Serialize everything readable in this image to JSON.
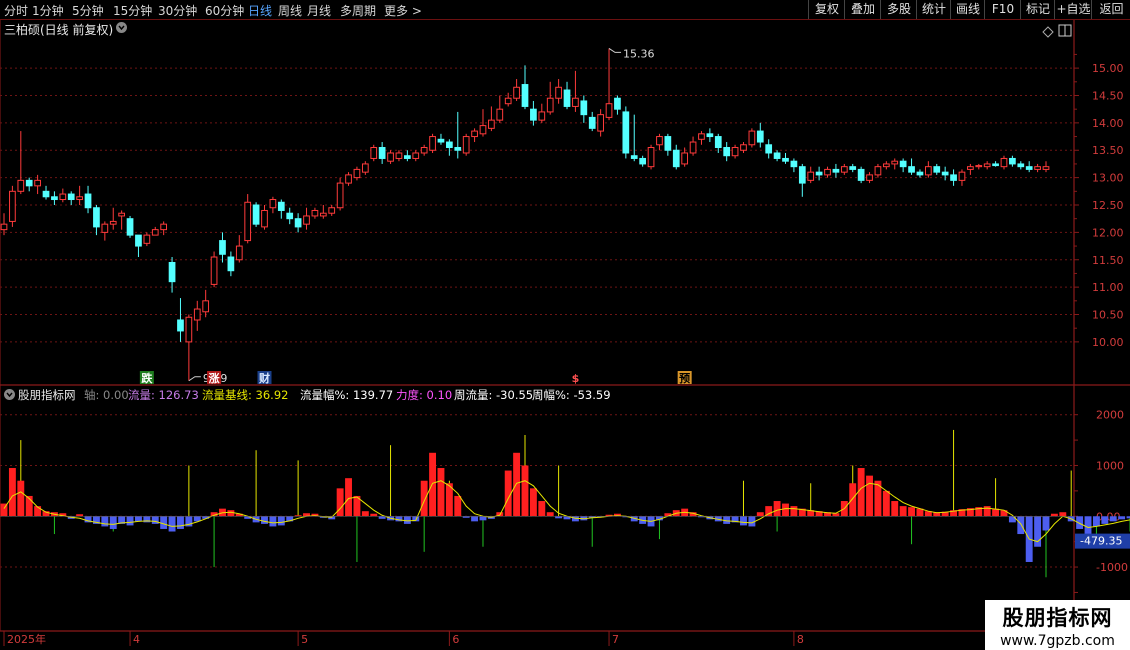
{
  "toolbar": {
    "periods": [
      "分时",
      "1分钟",
      "5分钟",
      "15分钟",
      "30分钟",
      "60分钟",
      "日线",
      "周线",
      "月线",
      "多周期",
      "更多 >"
    ],
    "active_period": "日线",
    "right_buttons": [
      "复权",
      "叠加",
      "多股",
      "统计",
      "画线",
      "F10",
      "标记",
      "+自选",
      "返回"
    ]
  },
  "main_chart": {
    "title": "三柏硕(日线 前复权)",
    "y_ticks": [
      "15.00",
      "14.50",
      "14.00",
      "13.50",
      "13.00",
      "12.50",
      "12.00",
      "11.50",
      "11.00",
      "10.50",
      "10.00"
    ],
    "y_range": [
      9.45,
      15.55
    ],
    "high_marker": "15.36",
    "low_marker": "9.29",
    "event_labels": [
      {
        "text": "跌",
        "color": "#ffffff",
        "bg": "#1e7d1e",
        "index": 17
      },
      {
        "text": "涨",
        "color": "#ffffff",
        "bg": "#b01818",
        "index": 25
      },
      {
        "text": "财",
        "color": "#d8e8ff",
        "bg": "#1a3f8a",
        "index": 31
      },
      {
        "text": "$",
        "color": "#ff5050",
        "bg": "transparent",
        "index": 68
      },
      {
        "text": "预",
        "color": "#000000",
        "bg": "#d9962a",
        "index": 81
      }
    ]
  },
  "indicator": {
    "name": "股朋指标网",
    "items": [
      {
        "label": "轴:",
        "value": "0.00",
        "color": "#777777"
      },
      {
        "label": "流量:",
        "value": "126.73",
        "color": "#c77de8"
      },
      {
        "label": "流量基线:",
        "value": "36.92",
        "color": "#e6e600"
      },
      {
        "label": "流量幅%:",
        "value": "139.77",
        "color": "#ffffff"
      },
      {
        "label": "力度:",
        "value": "0.10",
        "color": "#ff55ff"
      },
      {
        "label": "周流量:",
        "value": "-30.55",
        "color": "#ffffff"
      },
      {
        "label": "周幅%:",
        "value": "-53.59",
        "color": "#ffffff"
      }
    ],
    "y_ticks": [
      "2000",
      "1000",
      "0.00",
      "-1000"
    ],
    "y_range": [
      -2200,
      2250
    ],
    "current_value": "-479.35"
  },
  "x_axis": {
    "labels": [
      {
        "text": "2025年",
        "index": 0
      },
      {
        "text": "4",
        "index": 15
      },
      {
        "text": "5",
        "index": 35
      },
      {
        "text": "6",
        "index": 53
      },
      {
        "text": "7",
        "index": 72
      },
      {
        "text": "8",
        "index": 94
      }
    ]
  },
  "watermark": {
    "line1": "股朋指标网",
    "line2": "www.7gpzb.com"
  },
  "colors": {
    "up": "#ff3b3b",
    "down": "#54ffff",
    "grid": "#6e1414",
    "baseline": "#e6e600",
    "vol_up": "#ff2020",
    "vol_down": "#4d5ef0",
    "spike_up": "#e6e600",
    "spike_down": "#22c522"
  },
  "chart_data": {
    "type": "candlestick",
    "title": "三柏硕(日线 前复权)",
    "candles": [
      [
        12.05,
        12.15,
        12.35,
        11.95
      ],
      [
        12.2,
        12.75,
        12.85,
        12.1
      ],
      [
        12.75,
        12.95,
        13.85,
        12.7
      ],
      [
        12.95,
        12.85,
        13.0,
        12.75
      ],
      [
        12.85,
        12.95,
        13.05,
        12.7
      ],
      [
        12.75,
        12.65,
        12.85,
        12.6
      ],
      [
        12.65,
        12.6,
        12.75,
        12.5
      ],
      [
        12.6,
        12.7,
        12.8,
        12.55
      ],
      [
        12.7,
        12.6,
        12.75,
        12.5
      ],
      [
        12.6,
        12.65,
        12.85,
        12.5
      ],
      [
        12.7,
        12.45,
        12.85,
        12.35
      ],
      [
        12.45,
        12.1,
        12.5,
        11.95
      ],
      [
        12.0,
        12.15,
        12.2,
        11.85
      ],
      [
        12.15,
        12.2,
        12.45,
        12.05
      ],
      [
        12.3,
        12.35,
        12.4,
        12.05
      ],
      [
        12.25,
        11.95,
        12.3,
        11.9
      ],
      [
        11.95,
        11.75,
        11.95,
        11.55
      ],
      [
        11.8,
        11.95,
        12.0,
        11.75
      ],
      [
        11.95,
        12.05,
        12.1,
        11.95
      ],
      [
        12.05,
        12.15,
        12.2,
        11.95
      ],
      [
        11.45,
        11.1,
        11.55,
        10.9
      ],
      [
        10.4,
        10.2,
        10.8,
        10.0
      ],
      [
        10.0,
        10.45,
        10.5,
        9.29
      ],
      [
        10.4,
        10.6,
        10.75,
        10.2
      ],
      [
        10.55,
        10.75,
        10.95,
        10.45
      ],
      [
        11.05,
        11.55,
        11.65,
        11.0
      ],
      [
        11.85,
        11.6,
        12.0,
        11.45
      ],
      [
        11.55,
        11.3,
        11.65,
        11.2
      ],
      [
        11.5,
        11.75,
        11.95,
        11.45
      ],
      [
        11.85,
        12.55,
        12.7,
        11.8
      ],
      [
        12.5,
        12.15,
        12.55,
        12.1
      ],
      [
        12.1,
        12.4,
        12.5,
        12.05
      ],
      [
        12.45,
        12.6,
        12.65,
        12.35
      ],
      [
        12.55,
        12.4,
        12.6,
        12.25
      ],
      [
        12.35,
        12.25,
        12.45,
        12.15
      ],
      [
        12.25,
        12.1,
        12.35,
        12.0
      ],
      [
        12.15,
        12.3,
        12.45,
        12.05
      ],
      [
        12.3,
        12.4,
        12.45,
        12.25
      ],
      [
        12.3,
        12.35,
        12.5,
        12.25
      ],
      [
        12.35,
        12.45,
        12.5,
        12.3
      ],
      [
        12.45,
        12.9,
        13.0,
        12.4
      ],
      [
        12.9,
        13.05,
        13.1,
        12.85
      ],
      [
        13.0,
        13.15,
        13.2,
        12.95
      ],
      [
        13.1,
        13.25,
        13.3,
        13.05
      ],
      [
        13.35,
        13.55,
        13.6,
        13.3
      ],
      [
        13.55,
        13.35,
        13.65,
        13.25
      ],
      [
        13.3,
        13.45,
        13.5,
        13.25
      ],
      [
        13.35,
        13.45,
        13.5,
        13.3
      ],
      [
        13.4,
        13.35,
        13.5,
        13.3
      ],
      [
        13.35,
        13.45,
        13.5,
        13.3
      ],
      [
        13.45,
        13.55,
        13.6,
        13.4
      ],
      [
        13.5,
        13.75,
        13.8,
        13.45
      ],
      [
        13.7,
        13.65,
        13.8,
        13.6
      ],
      [
        13.65,
        13.55,
        13.7,
        13.4
      ],
      [
        13.55,
        13.5,
        14.2,
        13.35
      ],
      [
        13.45,
        13.75,
        13.8,
        13.4
      ],
      [
        13.75,
        13.85,
        13.9,
        13.65
      ],
      [
        13.8,
        13.95,
        14.25,
        13.75
      ],
      [
        13.9,
        14.05,
        14.3,
        13.85
      ],
      [
        14.05,
        14.25,
        14.5,
        14.0
      ],
      [
        14.35,
        14.45,
        14.55,
        14.3
      ],
      [
        14.45,
        14.65,
        14.8,
        14.4
      ],
      [
        14.7,
        14.3,
        15.05,
        14.25
      ],
      [
        14.25,
        14.05,
        14.4,
        13.95
      ],
      [
        14.05,
        14.2,
        14.35,
        14.0
      ],
      [
        14.2,
        14.45,
        14.75,
        14.15
      ],
      [
        14.45,
        14.65,
        14.8,
        14.35
      ],
      [
        14.6,
        14.3,
        14.75,
        14.25
      ],
      [
        14.3,
        14.45,
        14.95,
        14.2
      ],
      [
        14.4,
        14.15,
        14.5,
        14.0
      ],
      [
        14.1,
        13.9,
        14.2,
        13.85
      ],
      [
        13.85,
        14.15,
        14.25,
        13.75
      ],
      [
        14.1,
        14.35,
        15.36,
        14.05
      ],
      [
        14.45,
        14.25,
        14.5,
        14.15
      ],
      [
        14.2,
        13.45,
        14.3,
        13.35
      ],
      [
        13.4,
        13.35,
        14.15,
        13.3
      ],
      [
        13.35,
        13.25,
        13.4,
        13.2
      ],
      [
        13.2,
        13.55,
        13.6,
        13.15
      ],
      [
        13.6,
        13.75,
        13.8,
        13.5
      ],
      [
        13.75,
        13.5,
        13.8,
        13.4
      ],
      [
        13.5,
        13.2,
        13.6,
        13.15
      ],
      [
        13.25,
        13.45,
        13.55,
        13.2
      ],
      [
        13.45,
        13.65,
        13.75,
        13.4
      ],
      [
        13.7,
        13.8,
        13.85,
        13.6
      ],
      [
        13.8,
        13.75,
        13.9,
        13.65
      ],
      [
        13.75,
        13.55,
        13.8,
        13.45
      ],
      [
        13.55,
        13.4,
        13.65,
        13.3
      ],
      [
        13.4,
        13.55,
        13.6,
        13.35
      ],
      [
        13.5,
        13.6,
        13.65,
        13.45
      ],
      [
        13.6,
        13.85,
        13.9,
        13.55
      ],
      [
        13.85,
        13.65,
        14.0,
        13.55
      ],
      [
        13.6,
        13.45,
        13.7,
        13.35
      ],
      [
        13.45,
        13.35,
        13.5,
        13.3
      ],
      [
        13.35,
        13.3,
        13.45,
        13.25
      ],
      [
        13.3,
        13.2,
        13.35,
        13.1
      ],
      [
        13.2,
        12.9,
        13.25,
        12.65
      ],
      [
        12.95,
        13.1,
        13.2,
        12.9
      ],
      [
        13.1,
        13.05,
        13.2,
        12.95
      ],
      [
        13.05,
        13.15,
        13.2,
        13.0
      ],
      [
        13.15,
        13.1,
        13.25,
        13.0
      ],
      [
        13.1,
        13.2,
        13.25,
        13.05
      ],
      [
        13.2,
        13.15,
        13.25,
        13.1
      ],
      [
        13.15,
        12.95,
        13.2,
        12.9
      ],
      [
        12.95,
        13.05,
        13.1,
        12.9
      ],
      [
        13.05,
        13.2,
        13.25,
        13.0
      ],
      [
        13.2,
        13.25,
        13.3,
        13.15
      ],
      [
        13.25,
        13.3,
        13.35,
        13.15
      ],
      [
        13.3,
        13.2,
        13.35,
        13.1
      ],
      [
        13.2,
        13.1,
        13.35,
        13.05
      ],
      [
        13.1,
        13.05,
        13.15,
        13.0
      ],
      [
        13.05,
        13.2,
        13.3,
        13.0
      ],
      [
        13.2,
        13.1,
        13.25,
        13.05
      ],
      [
        13.1,
        13.05,
        13.2,
        12.95
      ],
      [
        13.05,
        12.95,
        13.15,
        12.85
      ],
      [
        12.95,
        13.1,
        13.15,
        12.85
      ],
      [
        13.15,
        13.2,
        13.25,
        13.05
      ],
      [
        13.2,
        13.22,
        13.25,
        13.15
      ],
      [
        13.2,
        13.25,
        13.3,
        13.15
      ],
      [
        13.25,
        13.22,
        13.3,
        13.2
      ],
      [
        13.2,
        13.35,
        13.4,
        13.15
      ],
      [
        13.35,
        13.25,
        13.4,
        13.2
      ],
      [
        13.25,
        13.2,
        13.3,
        13.15
      ],
      [
        13.2,
        13.15,
        13.3,
        13.1
      ],
      [
        13.15,
        13.2,
        13.25,
        13.1
      ],
      [
        13.15,
        13.2,
        13.3,
        13.1
      ]
    ],
    "flow": [
      250,
      950,
      700,
      400,
      200,
      100,
      80,
      60,
      -50,
      40,
      -120,
      -150,
      -200,
      -250,
      -150,
      -180,
      -100,
      -120,
      -150,
      -250,
      -300,
      -250,
      -200,
      -100,
      -50,
      80,
      150,
      120,
      50,
      -50,
      -120,
      -150,
      -200,
      -180,
      -100,
      20,
      60,
      50,
      -30,
      -60,
      550,
      750,
      400,
      100,
      50,
      -50,
      -80,
      -100,
      -150,
      -100,
      700,
      1250,
      950,
      650,
      400,
      -30,
      -100,
      -80,
      -50,
      80,
      900,
      1250,
      1000,
      550,
      300,
      80,
      -40,
      -60,
      -100,
      -80,
      -30,
      -20,
      30,
      50,
      -10,
      -100,
      -150,
      -200,
      -80,
      60,
      120,
      150,
      80,
      -20,
      -60,
      -100,
      -150,
      -120,
      -180,
      -200,
      80,
      200,
      300,
      250,
      200,
      150,
      120,
      100,
      80,
      60,
      300,
      650,
      950,
      800,
      700,
      500,
      300,
      200,
      180,
      150,
      100,
      80,
      90,
      120,
      140,
      160,
      180,
      200,
      150,
      120,
      -120,
      -350,
      -900,
      -600,
      -280,
      50,
      80,
      -100,
      -250,
      -350,
      -200,
      -150,
      -100,
      -60,
      -40,
      80,
      120,
      -50,
      -80,
      -60
    ],
    "baseline": [
      150,
      400,
      480,
      350,
      180,
      80,
      40,
      10,
      -20,
      -40,
      -90,
      -120,
      -150,
      -160,
      -130,
      -120,
      -100,
      -90,
      -100,
      -150,
      -200,
      -190,
      -160,
      -110,
      -50,
      20,
      70,
      80,
      50,
      0,
      -60,
      -100,
      -130,
      -120,
      -90,
      -40,
      0,
      10,
      -10,
      -20,
      150,
      350,
      380,
      250,
      120,
      20,
      -40,
      -70,
      -90,
      -80,
      300,
      650,
      700,
      600,
      450,
      200,
      50,
      0,
      -20,
      20,
      350,
      650,
      700,
      600,
      400,
      200,
      60,
      0,
      -40,
      -50,
      -30,
      -20,
      0,
      10,
      0,
      -40,
      -80,
      -100,
      -60,
      0,
      60,
      80,
      60,
      10,
      -30,
      -60,
      -90,
      -100,
      -120,
      -130,
      -50,
      50,
      120,
      150,
      150,
      130,
      110,
      90,
      70,
      60,
      150,
      350,
      550,
      650,
      620,
      500,
      380,
      270,
      200,
      150,
      100,
      70,
      80,
      100,
      120,
      130,
      150,
      160,
      140,
      120,
      20,
      -150,
      -450,
      -500,
      -350,
      -150,
      0,
      -50,
      -140,
      -220,
      -200,
      -170,
      -140,
      -100,
      -70,
      -30,
      10,
      -10,
      -40,
      -50
    ],
    "spikes": [
      [
        2,
        1500
      ],
      [
        6,
        -350
      ],
      [
        13,
        -300
      ],
      [
        22,
        1000
      ],
      [
        25,
        -1000
      ],
      [
        30,
        1300
      ],
      [
        35,
        1100
      ],
      [
        42,
        -900
      ],
      [
        46,
        1400
      ],
      [
        50,
        -700
      ],
      [
        53,
        700
      ],
      [
        57,
        -600
      ],
      [
        62,
        1600
      ],
      [
        66,
        1000
      ],
      [
        70,
        -600
      ],
      [
        78,
        -450
      ],
      [
        88,
        700
      ],
      [
        92,
        -300
      ],
      [
        96,
        650
      ],
      [
        101,
        1000
      ],
      [
        108,
        -550
      ],
      [
        113,
        1700
      ],
      [
        118,
        750
      ],
      [
        121,
        -300
      ],
      [
        124,
        -1200
      ],
      [
        127,
        900
      ],
      [
        130,
        -400
      ],
      [
        134,
        -300
      ],
      [
        138,
        400
      ],
      [
        141,
        -250
      ],
      [
        143,
        300
      ],
      [
        145,
        -200
      ]
    ]
  }
}
